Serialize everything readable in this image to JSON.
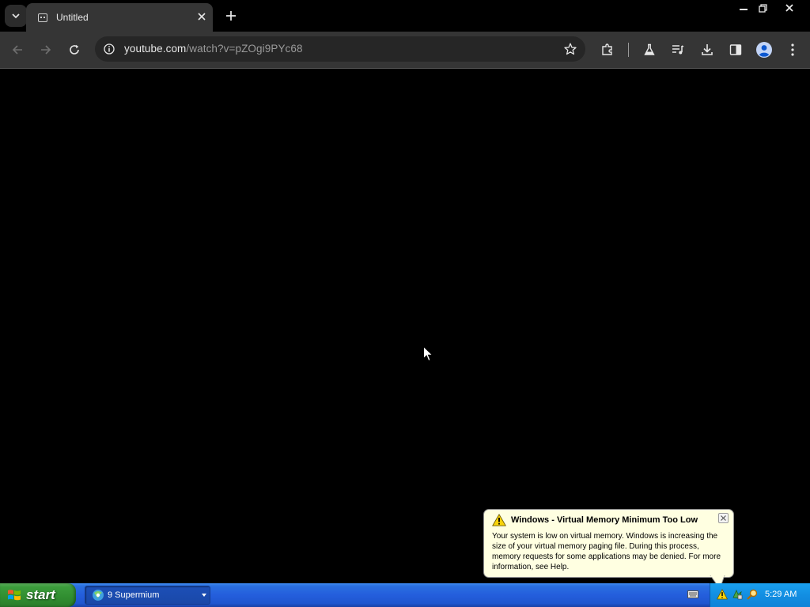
{
  "browser": {
    "tab": {
      "title": "Untitled"
    },
    "address_bar": {
      "url_host": "youtube.com",
      "url_path": "/watch?v=pZOgi9PYc68"
    }
  },
  "balloon": {
    "title": "Windows - Virtual Memory Minimum Too Low",
    "message": "Your system is low on virtual memory. Windows is increasing the size of your virtual memory paging file. During this process, memory requests for some applications may be denied. For more information, see Help."
  },
  "taskbar": {
    "start_label": "start",
    "task_label": "9 Supermium",
    "clock": "5:29 AM"
  },
  "colors": {
    "taskbar_blue": "#245edc",
    "start_green": "#318f31",
    "tray_blue": "#128ee2",
    "balloon_bg": "#ffffe1",
    "toolbar_bg": "#353535"
  },
  "icons": [
    "tab-search-icon",
    "sad-tab-icon",
    "close-icon",
    "plus-icon",
    "minimize-icon",
    "restore-icon",
    "back-arrow-icon",
    "forward-arrow-icon",
    "reload-icon",
    "info-icon",
    "star-icon",
    "extensions-icon",
    "labs-flask-icon",
    "media-control-icon",
    "download-icon",
    "side-panel-icon",
    "profile-icon",
    "menu-dots-icon",
    "mouse-cursor-icon",
    "warning-icon",
    "windows-flag-icon",
    "supermium-browser-icon",
    "keyboard-icon",
    "network-icon",
    "search-icon"
  ]
}
